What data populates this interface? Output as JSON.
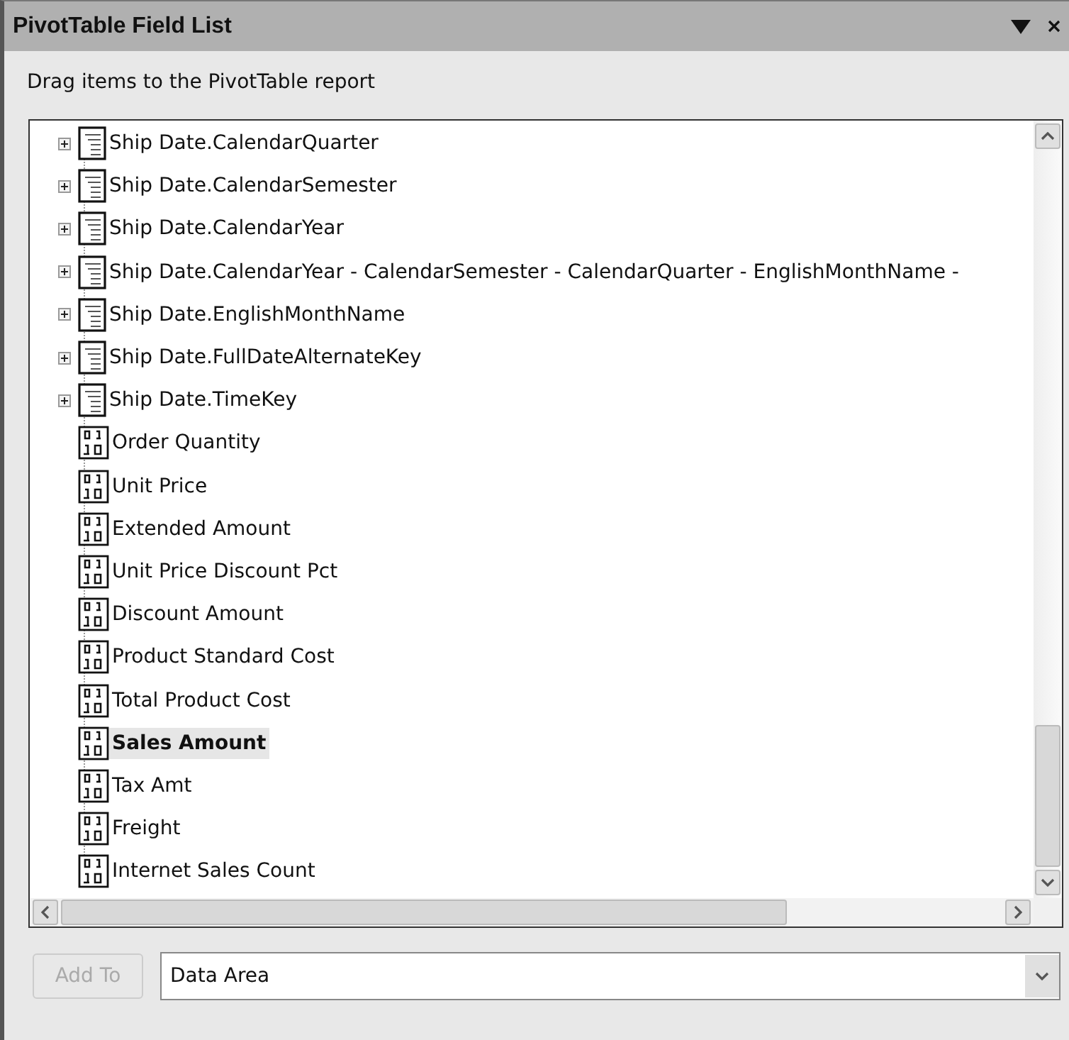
{
  "window": {
    "title": "PivotTable Field List"
  },
  "instruction": "Drag items to the PivotTable report",
  "fields": [
    {
      "kind": "hierarchy",
      "label": "Ship Date.CalendarQuarter",
      "expanded": false,
      "selected": false
    },
    {
      "kind": "hierarchy",
      "label": "Ship Date.CalendarSemester",
      "expanded": false,
      "selected": false
    },
    {
      "kind": "hierarchy",
      "label": "Ship Date.CalendarYear",
      "expanded": false,
      "selected": false
    },
    {
      "kind": "hierarchy",
      "label": "Ship Date.CalendarYear -  CalendarSemester -  CalendarQuarter -  EnglishMonthName -",
      "expanded": false,
      "selected": false
    },
    {
      "kind": "hierarchy",
      "label": "Ship Date.EnglishMonthName",
      "expanded": false,
      "selected": false
    },
    {
      "kind": "hierarchy",
      "label": "Ship Date.FullDateAlternateKey",
      "expanded": false,
      "selected": false
    },
    {
      "kind": "hierarchy",
      "label": "Ship Date.TimeKey",
      "expanded": false,
      "selected": false
    },
    {
      "kind": "measure",
      "label": "Order Quantity",
      "selected": false
    },
    {
      "kind": "measure",
      "label": "Unit Price",
      "selected": false
    },
    {
      "kind": "measure",
      "label": "Extended Amount",
      "selected": false
    },
    {
      "kind": "measure",
      "label": "Unit Price Discount Pct",
      "selected": false
    },
    {
      "kind": "measure",
      "label": "Discount Amount",
      "selected": false
    },
    {
      "kind": "measure",
      "label": "Product Standard Cost",
      "selected": false
    },
    {
      "kind": "measure",
      "label": "Total Product Cost",
      "selected": false
    },
    {
      "kind": "measure",
      "label": "Sales Amount",
      "selected": true
    },
    {
      "kind": "measure",
      "label": "Tax Amt",
      "selected": false
    },
    {
      "kind": "measure",
      "label": "Freight",
      "selected": false
    },
    {
      "kind": "measure",
      "label": "Internet Sales Count",
      "selected": false
    }
  ],
  "add_to_button": {
    "label": "Add To",
    "disabled": true
  },
  "area_dropdown": {
    "value": "Data Area"
  }
}
